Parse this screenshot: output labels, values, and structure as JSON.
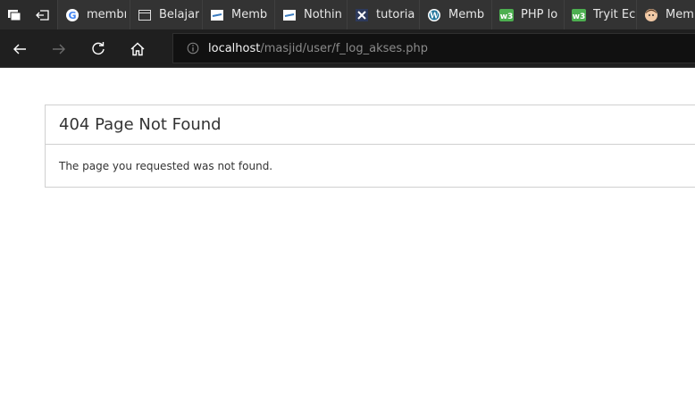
{
  "browser": {
    "tabs": [
      {
        "label": "membı",
        "favicon": "google-icon"
      },
      {
        "label": "Belajar",
        "favicon": "page-icon"
      },
      {
        "label": "Memb",
        "favicon": "site-icon"
      },
      {
        "label": "Nothin",
        "favicon": "site-icon"
      },
      {
        "label": "tutoria",
        "favicon": "x-icon"
      },
      {
        "label": "Memb",
        "favicon": "wordpress-icon"
      },
      {
        "label": "PHP lo",
        "favicon": "w3-icon"
      },
      {
        "label": "Tryit Ec",
        "favicon": "w3-icon"
      },
      {
        "label": "Memb",
        "favicon": "avatar-icon"
      }
    ],
    "address": {
      "host": "localhost",
      "path": "/masjid/user/f_log_akses.php"
    }
  },
  "page": {
    "error_title": "404 Page Not Found",
    "error_message": "The page you requested was not found."
  },
  "colors": {
    "tab_bar": "#2b2b2b",
    "address_bar": "#1f1f1f",
    "page_background": "#ffffff",
    "border": "#d0d0d0"
  }
}
